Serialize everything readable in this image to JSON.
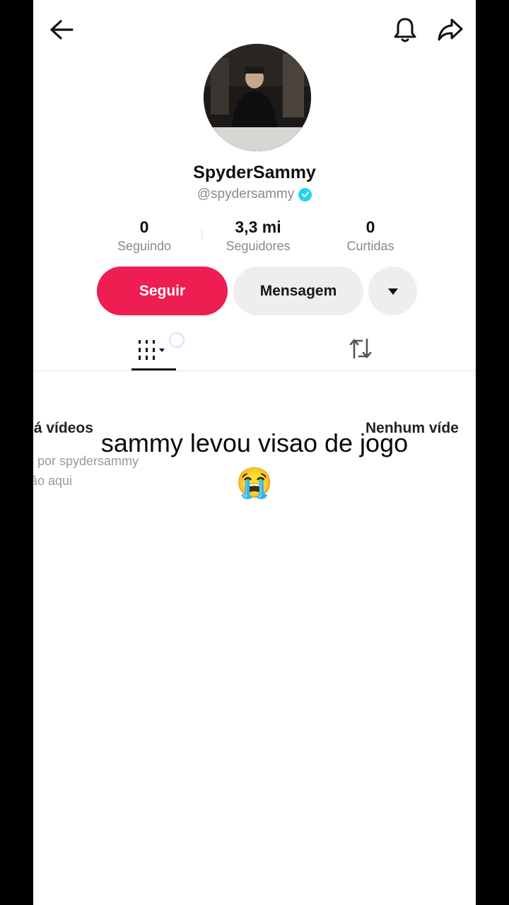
{
  "header": {
    "back_icon": "arrow-left-icon",
    "bell_icon": "bell-icon",
    "share_icon": "share-arrow-icon"
  },
  "profile": {
    "display_name": "SpyderSammy",
    "handle": "@spydersammy",
    "verified_icon": "verified-check-icon"
  },
  "stats": {
    "following": {
      "value": "0",
      "label": "Seguindo"
    },
    "followers": {
      "value": "3,3 mi",
      "label": "Seguidores"
    },
    "likes": {
      "value": "0",
      "label": "Curtidas"
    }
  },
  "actions": {
    "follow_label": "Seguir",
    "message_label": "Mensagem",
    "more_icon": "caret-down-icon"
  },
  "tabs": {
    "videos_icon": "grid-icon",
    "reposts_icon": "repost-icon"
  },
  "empty_state": {
    "left_title": "há vídeos",
    "left_sub1": "por spydersammy",
    "left_sub2": "rão aqui",
    "right_title": "Nenhum víde"
  },
  "overlay": {
    "caption": "sammy levou visao de jogo",
    "emoji": "😭"
  },
  "colors": {
    "follow": "#ee1d52",
    "verified": "#20d5ec",
    "secondary_btn": "#eeeeee"
  }
}
